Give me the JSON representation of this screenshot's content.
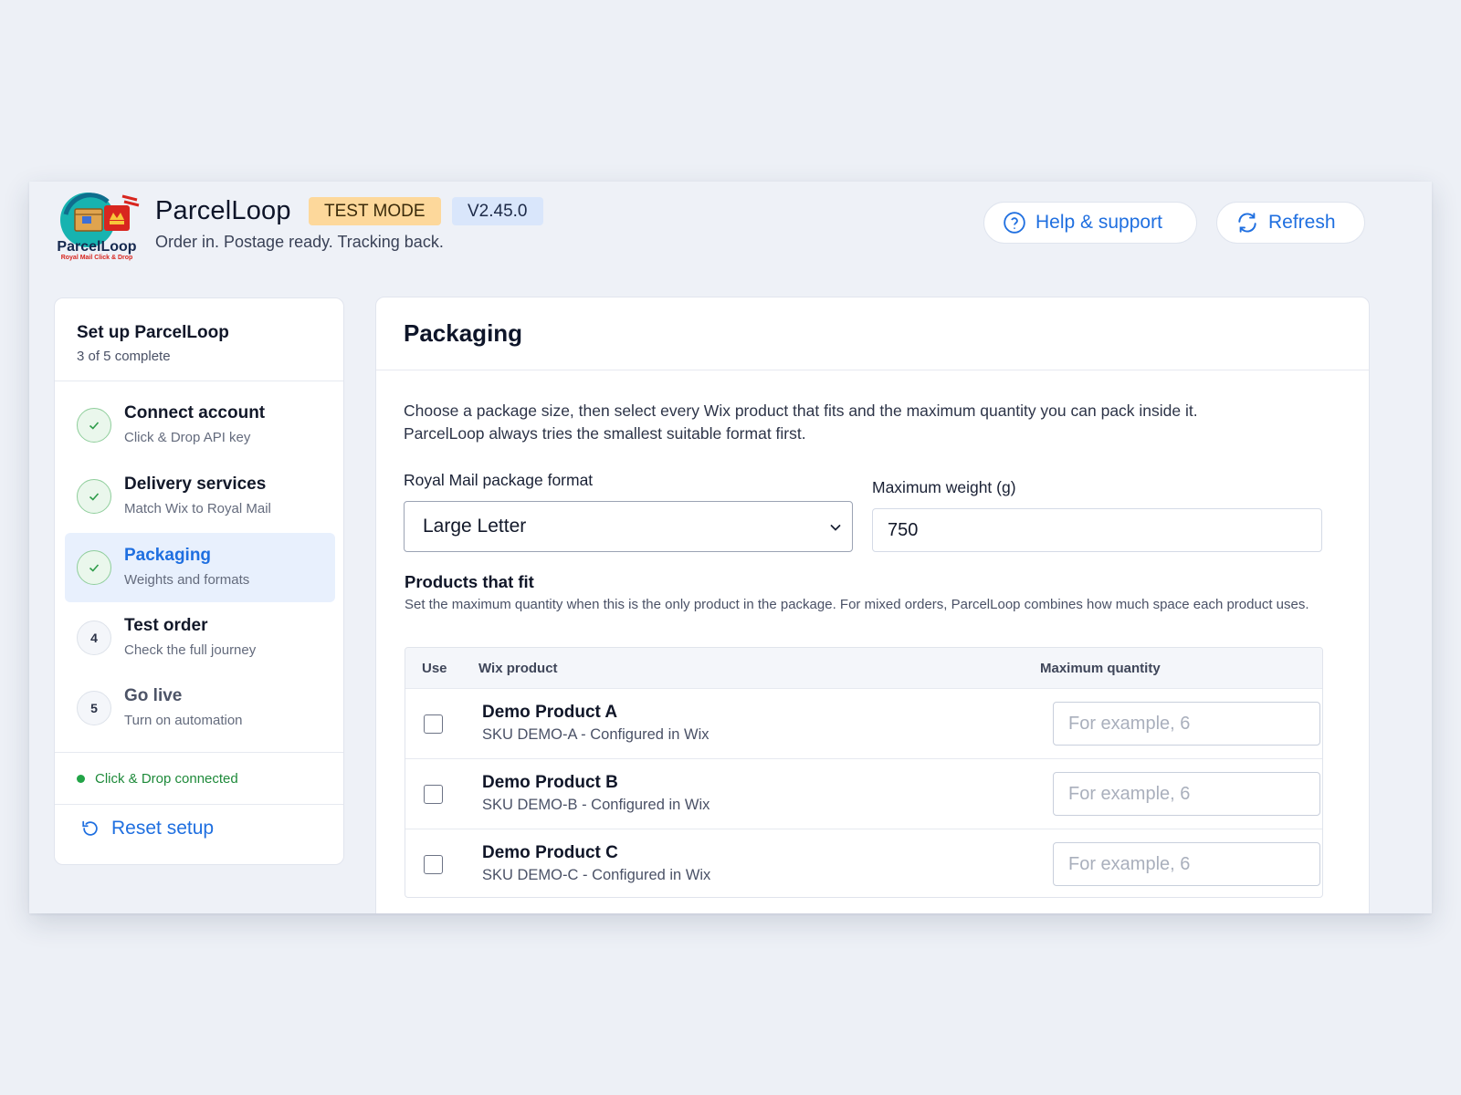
{
  "header": {
    "app_name": "ParcelLoop",
    "test_mode_badge": "TEST MODE",
    "version_badge": "V2.45.0",
    "tagline": "Order in. Postage ready. Tracking back.",
    "logo_text": "ParcelLoop",
    "logo_subtext": "Royal Mail Click & Drop",
    "help_label": "Help & support",
    "refresh_label": "Refresh"
  },
  "sidebar": {
    "title": "Set up ParcelLoop",
    "progress": "3 of 5 complete",
    "steps": [
      {
        "label": "Connect account",
        "desc": "Click & Drop API key",
        "status": "done"
      },
      {
        "label": "Delivery services",
        "desc": "Match Wix to Royal Mail",
        "status": "done"
      },
      {
        "label": "Packaging",
        "desc": "Weights and formats",
        "status": "done-active"
      },
      {
        "label": "Test order",
        "desc": "Check the full journey",
        "status": "pending",
        "number": "4"
      },
      {
        "label": "Go live",
        "desc": "Turn on automation",
        "status": "pending",
        "number": "5"
      }
    ],
    "connection_status": "Click & Drop connected",
    "reset_label": "Reset setup"
  },
  "panel": {
    "title": "Packaging",
    "intro_line1": "Choose a package size, then select every Wix product that fits and the maximum quantity you can pack inside it.",
    "intro_line2": "ParcelLoop always tries the smallest suitable format first.",
    "format_label": "Royal Mail package format",
    "format_value": "Large Letter",
    "weight_label": "Maximum weight (g)",
    "weight_value": "750",
    "products_title": "Products that fit",
    "products_desc": "Set the maximum quantity when this is the only product in the package. For mixed orders, ParcelLoop combines how much space each product uses.",
    "table": {
      "col_use": "Use",
      "col_product": "Wix product",
      "col_qty": "Maximum quantity",
      "rows": [
        {
          "name": "Demo Product A",
          "sku": "SKU DEMO-A - Configured in Wix",
          "placeholder": "For example, 6"
        },
        {
          "name": "Demo Product B",
          "sku": "SKU DEMO-B - Configured in Wix",
          "placeholder": "For example, 6"
        },
        {
          "name": "Demo Product C",
          "sku": "SKU DEMO-C - Configured in Wix",
          "placeholder": "For example, 6"
        }
      ]
    }
  },
  "colors": {
    "accent": "#1f6fe0",
    "test_badge": "#fdd89b",
    "version_badge": "#d9e6fb",
    "success": "#22a447"
  }
}
